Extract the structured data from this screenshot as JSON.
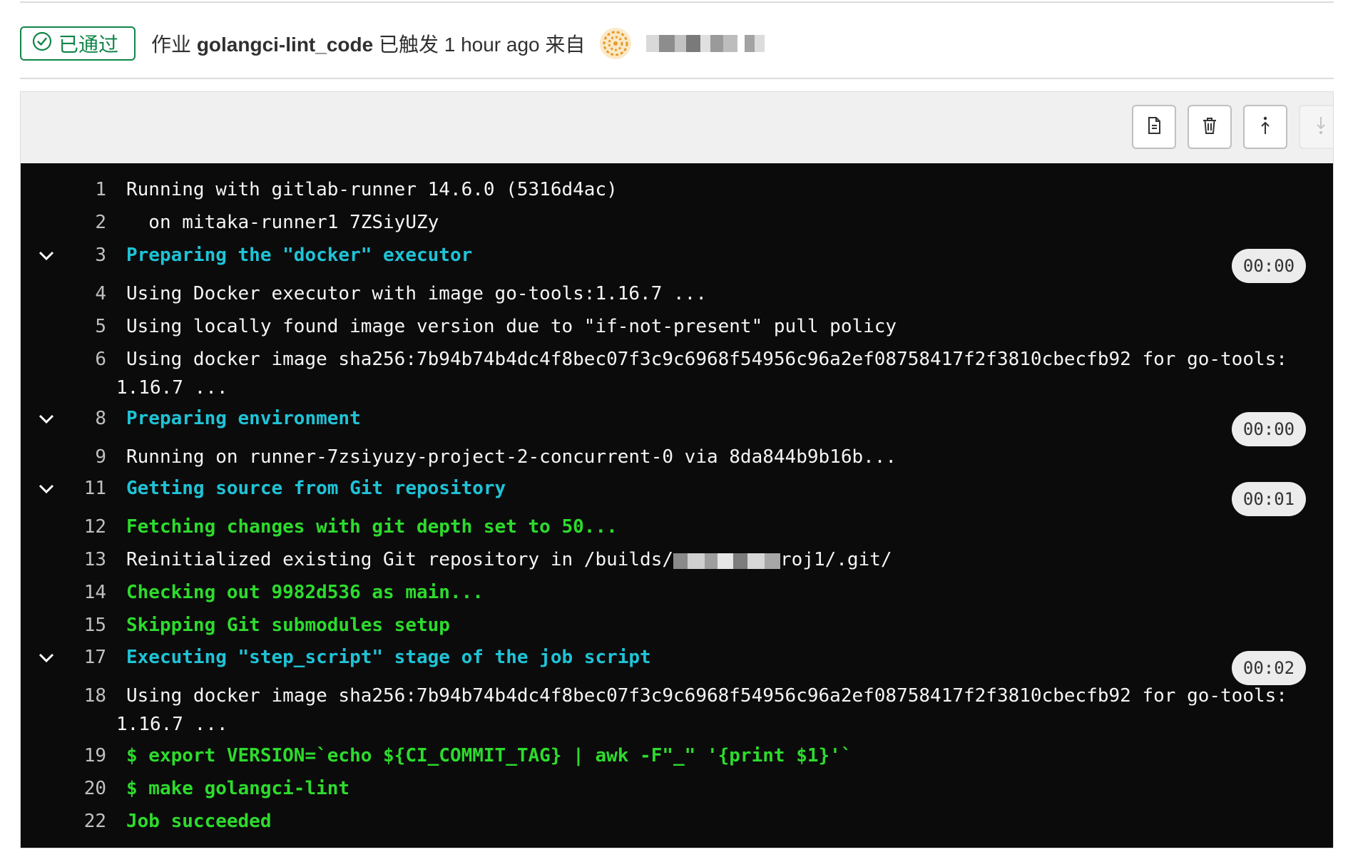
{
  "header": {
    "status_label": "已通过",
    "prefix": "作业",
    "job_name": "golangci-lint_code",
    "trigger_text": "已触发 1 hour ago 来自"
  },
  "log": {
    "lines": [
      {
        "num": "1",
        "text": "Running with gitlab-runner 14.6.0 (5316d4ac)"
      },
      {
        "num": "2",
        "text": "  on mitaka-runner1 7ZSiyUZy"
      },
      {
        "num": "3",
        "text": "Preparing the \"docker\" executor",
        "timer": "00:00"
      },
      {
        "num": "4",
        "text": "Using Docker executor with image go-tools:1.16.7 ..."
      },
      {
        "num": "5",
        "text": "Using locally found image version due to \"if-not-present\" pull policy"
      },
      {
        "num": "6",
        "text": "Using docker image sha256:7b94b74b4dc4f8bec07f3c9c6968f54956c96a2ef08758417f2f3810cbecfb92 for go-tools:",
        "cont": "1.16.7 ..."
      },
      {
        "num": "8",
        "text": "Preparing environment",
        "timer": "00:00"
      },
      {
        "num": "9",
        "text": "Running on runner-7zsiyuzy-project-2-concurrent-0 via 8da844b9b16b..."
      },
      {
        "num": "11",
        "text": "Getting source from Git repository",
        "timer": "00:01"
      },
      {
        "num": "12",
        "text": "Fetching changes with git depth set to 50..."
      },
      {
        "num": "13",
        "text_a": "Reinitialized existing Git repository in /builds/",
        "text_b": "roj1/.git/"
      },
      {
        "num": "14",
        "text": "Checking out 9982d536 as main..."
      },
      {
        "num": "15",
        "text": "Skipping Git submodules setup"
      },
      {
        "num": "17",
        "text": "Executing \"step_script\" stage of the job script",
        "timer": "00:02"
      },
      {
        "num": "18",
        "text": "Using docker image sha256:7b94b74b4dc4f8bec07f3c9c6968f54956c96a2ef08758417f2f3810cbecfb92 for go-tools:",
        "cont": "1.16.7 ..."
      },
      {
        "num": "19",
        "text": "$ export VERSION=`echo ${CI_COMMIT_TAG} | awk -F\"_\" '{print $1}'`"
      },
      {
        "num": "20",
        "text": "$ make golangci-lint"
      },
      {
        "num": "22",
        "text": "Job succeeded"
      }
    ]
  },
  "colors": {
    "success": "#108548",
    "section_header": "#1fc3d6",
    "command_green": "#2ddb2d",
    "terminal_bg": "#0b0b0b"
  },
  "icons": {
    "status": "check-circle-icon",
    "toolbar": [
      "raw-log-icon",
      "erase-log-icon",
      "scroll-top-icon",
      "scroll-bottom-icon"
    ],
    "section": "chevron-down-icon"
  }
}
